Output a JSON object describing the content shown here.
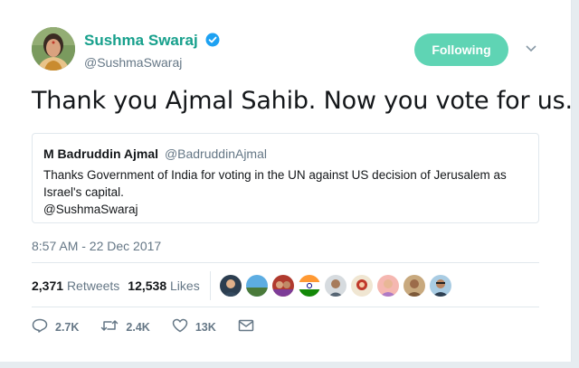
{
  "author": {
    "display_name": "Sushma Swaraj",
    "handle": "@SushmaSwaraj",
    "follow_label": "Following"
  },
  "tweet": {
    "text": "Thank you Ajmal Sahib. Now you vote for us.",
    "timestamp": "8:57 AM - 22 Dec 2017"
  },
  "quoted": {
    "name": "M Badruddin Ajmal",
    "handle": "@BadruddinAjmal",
    "lines": [
      "Thanks Government of India for voting in the UN against US decision of Jerusalem as",
      "Israel's capital.",
      "@SushmaSwaraj"
    ]
  },
  "stats": {
    "retweets_count": "2,371",
    "retweets_label": "Retweets",
    "likes_count": "12,538",
    "likes_label": "Likes"
  },
  "actions": {
    "reply_count": "2.7K",
    "retweet_count": "2.4K",
    "like_count": "13K"
  },
  "colors": {
    "accent": "#17a08c",
    "follow_button": "#5fd4b4",
    "muted": "#657786",
    "verified": "#1da1f2"
  }
}
